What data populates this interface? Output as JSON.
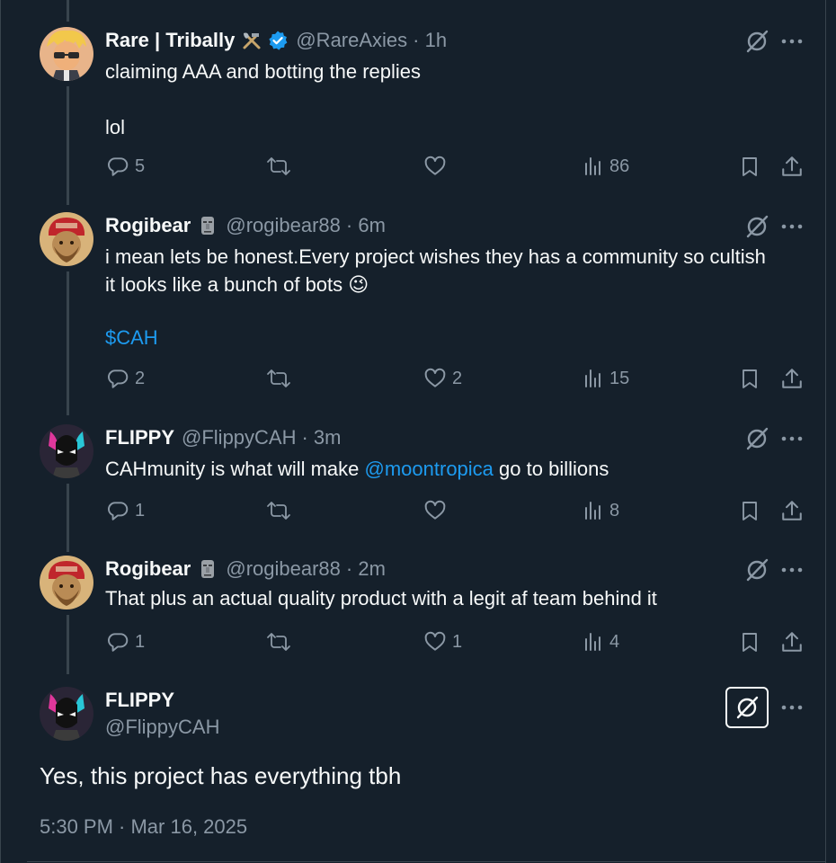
{
  "tweets": [
    {
      "name": "Rare | Tribally",
      "badge": "tools-emoji",
      "verified": true,
      "handle": "@RareAxies",
      "time": "· 1h",
      "lines": [
        "claiming AAA and botting the replies",
        "",
        "lol"
      ],
      "replies": "5",
      "retweets": "",
      "likes": "",
      "views": "86"
    },
    {
      "name": "Rogibear",
      "badge": "moai-emoji",
      "verified": false,
      "handle": "@rogibear88",
      "time": "· 6m",
      "line1": "i mean lets be honest.Every project wishes they has a community so cultish",
      "line2": "it looks like a bunch of bots",
      "line2_emoji": "😉",
      "cashtag": "$CAH",
      "replies": "2",
      "retweets": "",
      "likes": "2",
      "views": "15"
    },
    {
      "name": "FLIPPY",
      "handle": "@FlippyCAH",
      "time": "· 3m",
      "text_before": "CAHmunity is what will make ",
      "mention": "@moontropica",
      "text_after": " go to billions",
      "replies": "1",
      "retweets": "",
      "likes": "",
      "views": "8"
    },
    {
      "name": "Rogibear",
      "badge": "moai-emoji",
      "handle": "@rogibear88",
      "time": "· 2m",
      "text": "That plus an actual quality product with a legit af team behind it",
      "replies": "1",
      "retweets": "",
      "likes": "1",
      "views": "4"
    }
  ],
  "main": {
    "name": "FLIPPY",
    "handle": "@FlippyCAH",
    "text": "Yes, this project has everything tbh",
    "timestamp": "5:30 PM · Mar 16, 2025"
  },
  "colors": {
    "background": "#15202b",
    "text": "#f7f9f9",
    "muted": "#8b98a5",
    "link": "#1d9bf0",
    "divider": "#38444d"
  }
}
